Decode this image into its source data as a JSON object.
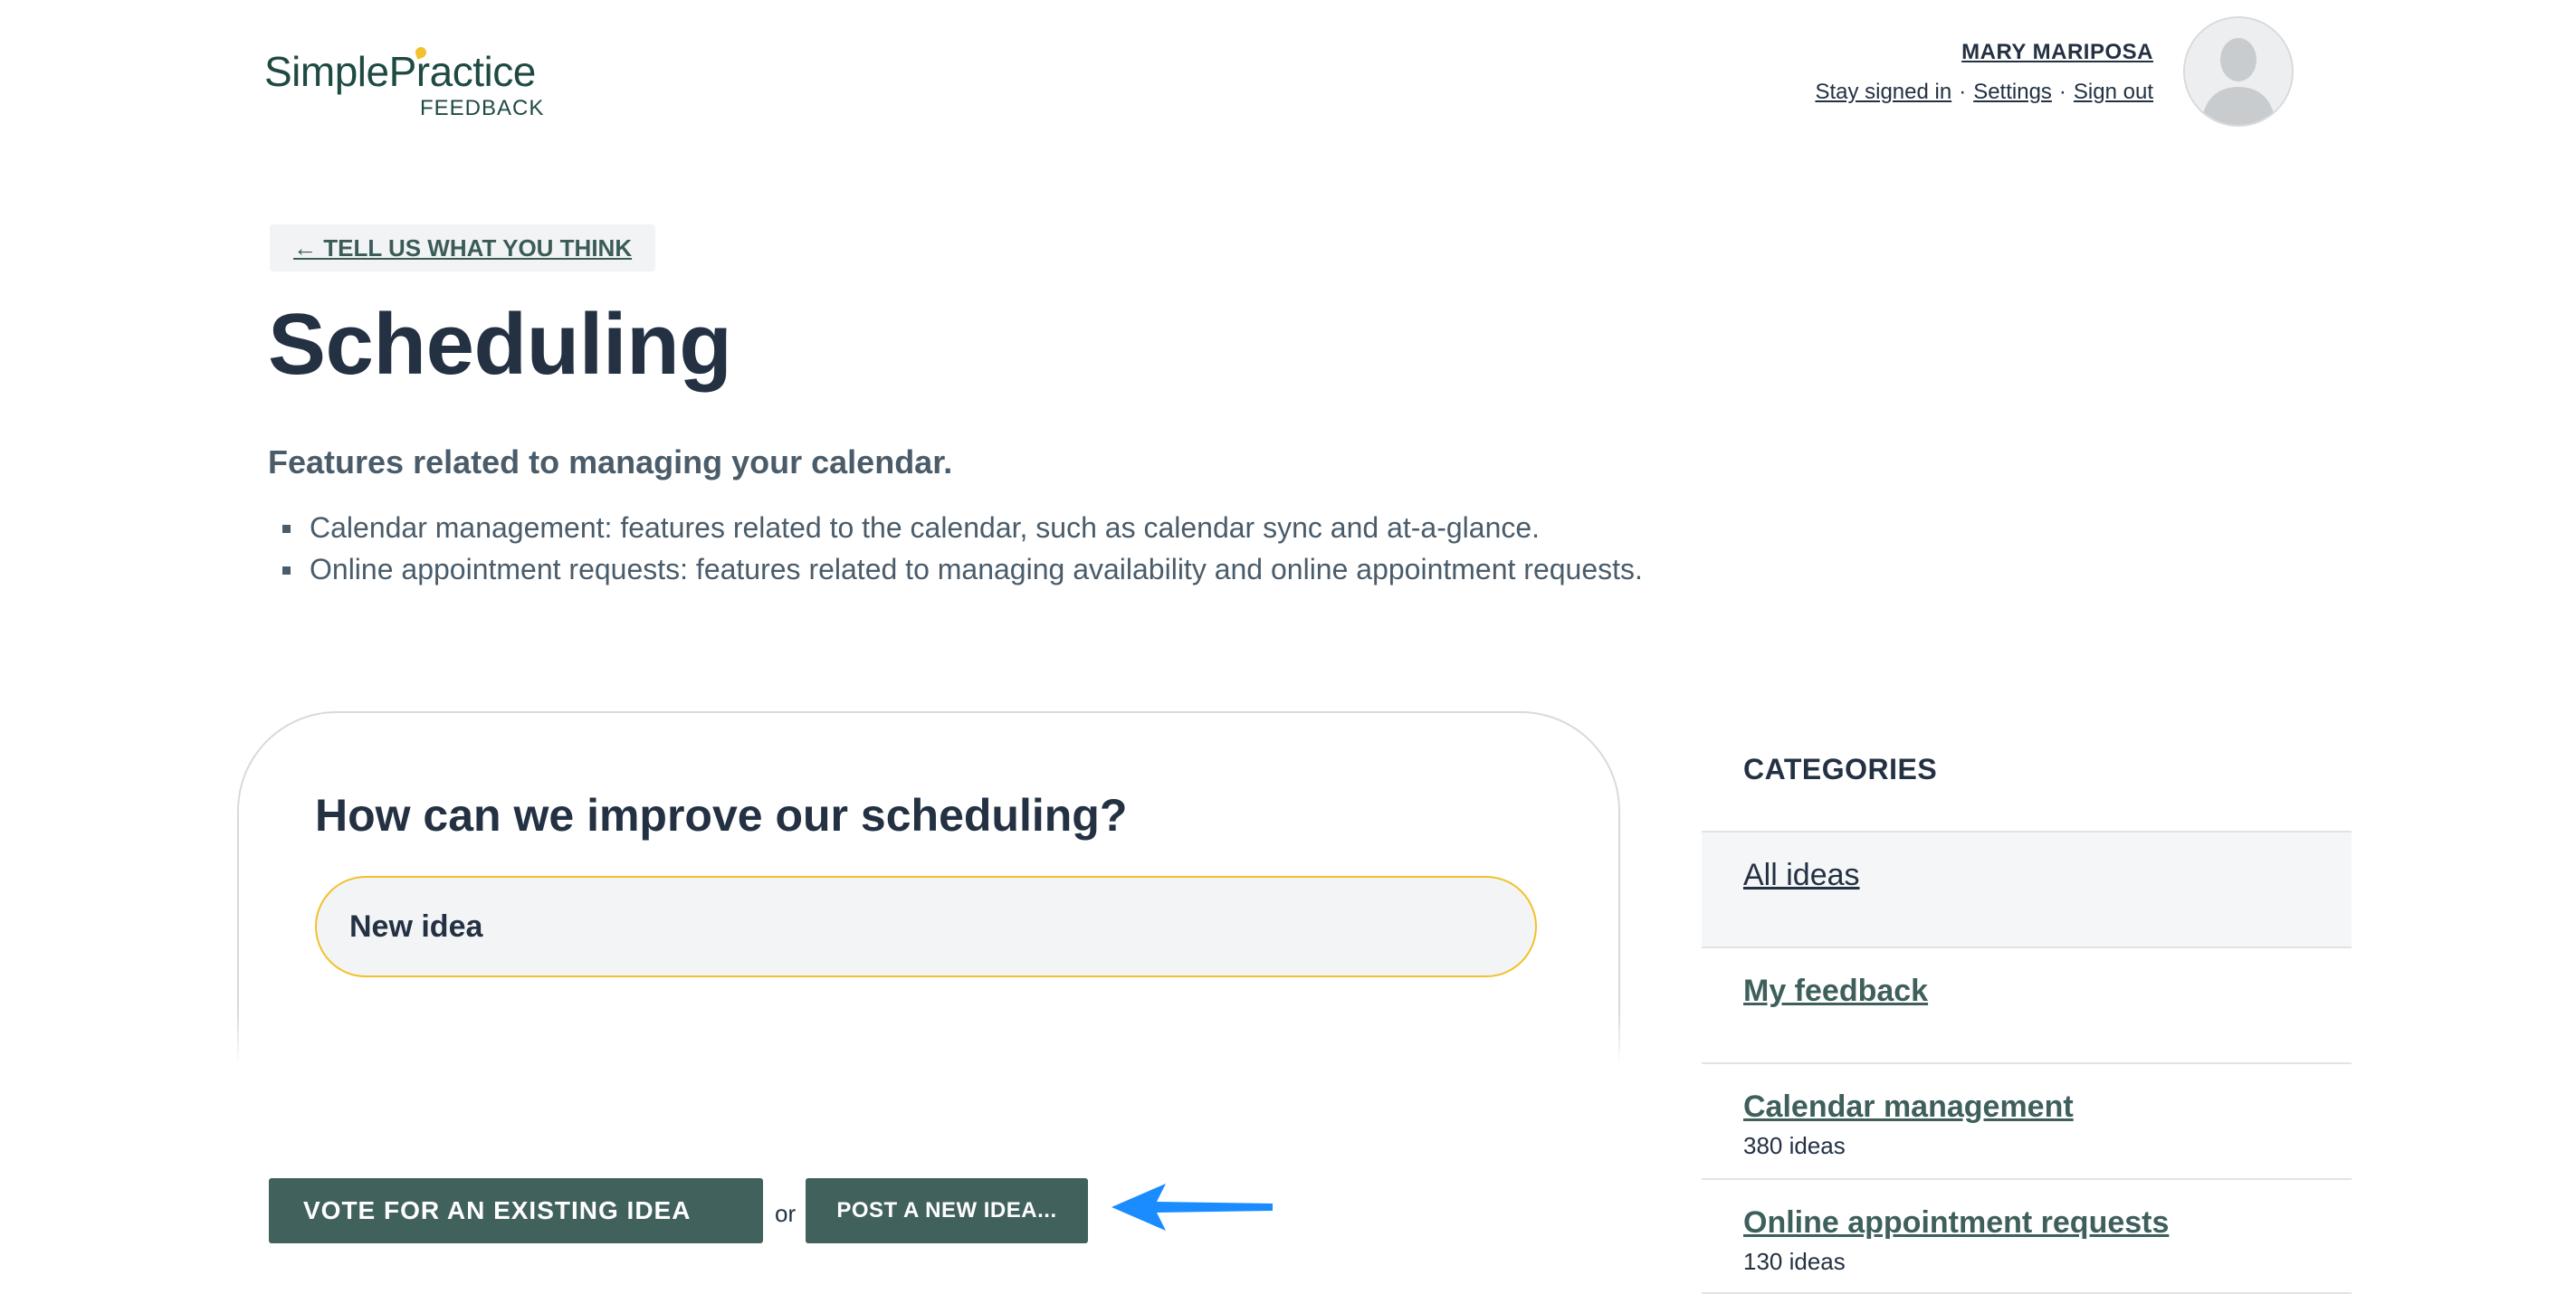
{
  "header": {
    "logo_text": "SimplePractice",
    "logo_sub": "FEEDBACK",
    "user_name": "MARY MARIPOSA",
    "links": [
      "Stay signed in",
      "Settings",
      "Sign out"
    ],
    "avatar_icon": "user-silhouette-icon"
  },
  "main": {
    "back_label": "← TELL US WHAT YOU THINK",
    "title": "Scheduling",
    "subtitle": "Features related to managing your calendar.",
    "bullets": [
      "Calendar management: features related to the calendar, such as calendar sync and at-a-glance.",
      "Online appointment requests: features related to managing availability and online appointment requests."
    ]
  },
  "idea_card": {
    "question": "How can we improve our scheduling?",
    "input_placeholder": "New idea",
    "input_value": ""
  },
  "actions": {
    "vote_label": "VOTE FOR AN EXISTING IDEA",
    "or_label": "or",
    "post_label": "POST A NEW IDEA...",
    "arrow_color": "#1a8cff"
  },
  "categories": {
    "heading": "CATEGORIES",
    "items": [
      {
        "label": "All ideas",
        "count": ""
      },
      {
        "label": "My feedback",
        "count": ""
      },
      {
        "label": "Calendar management",
        "count": "380 ideas"
      },
      {
        "label": "Online appointment requests",
        "count": "130 ideas"
      }
    ]
  },
  "colors": {
    "accent": "#41615d",
    "brand_yellow": "#f2c12e",
    "text_dark": "#233143"
  }
}
